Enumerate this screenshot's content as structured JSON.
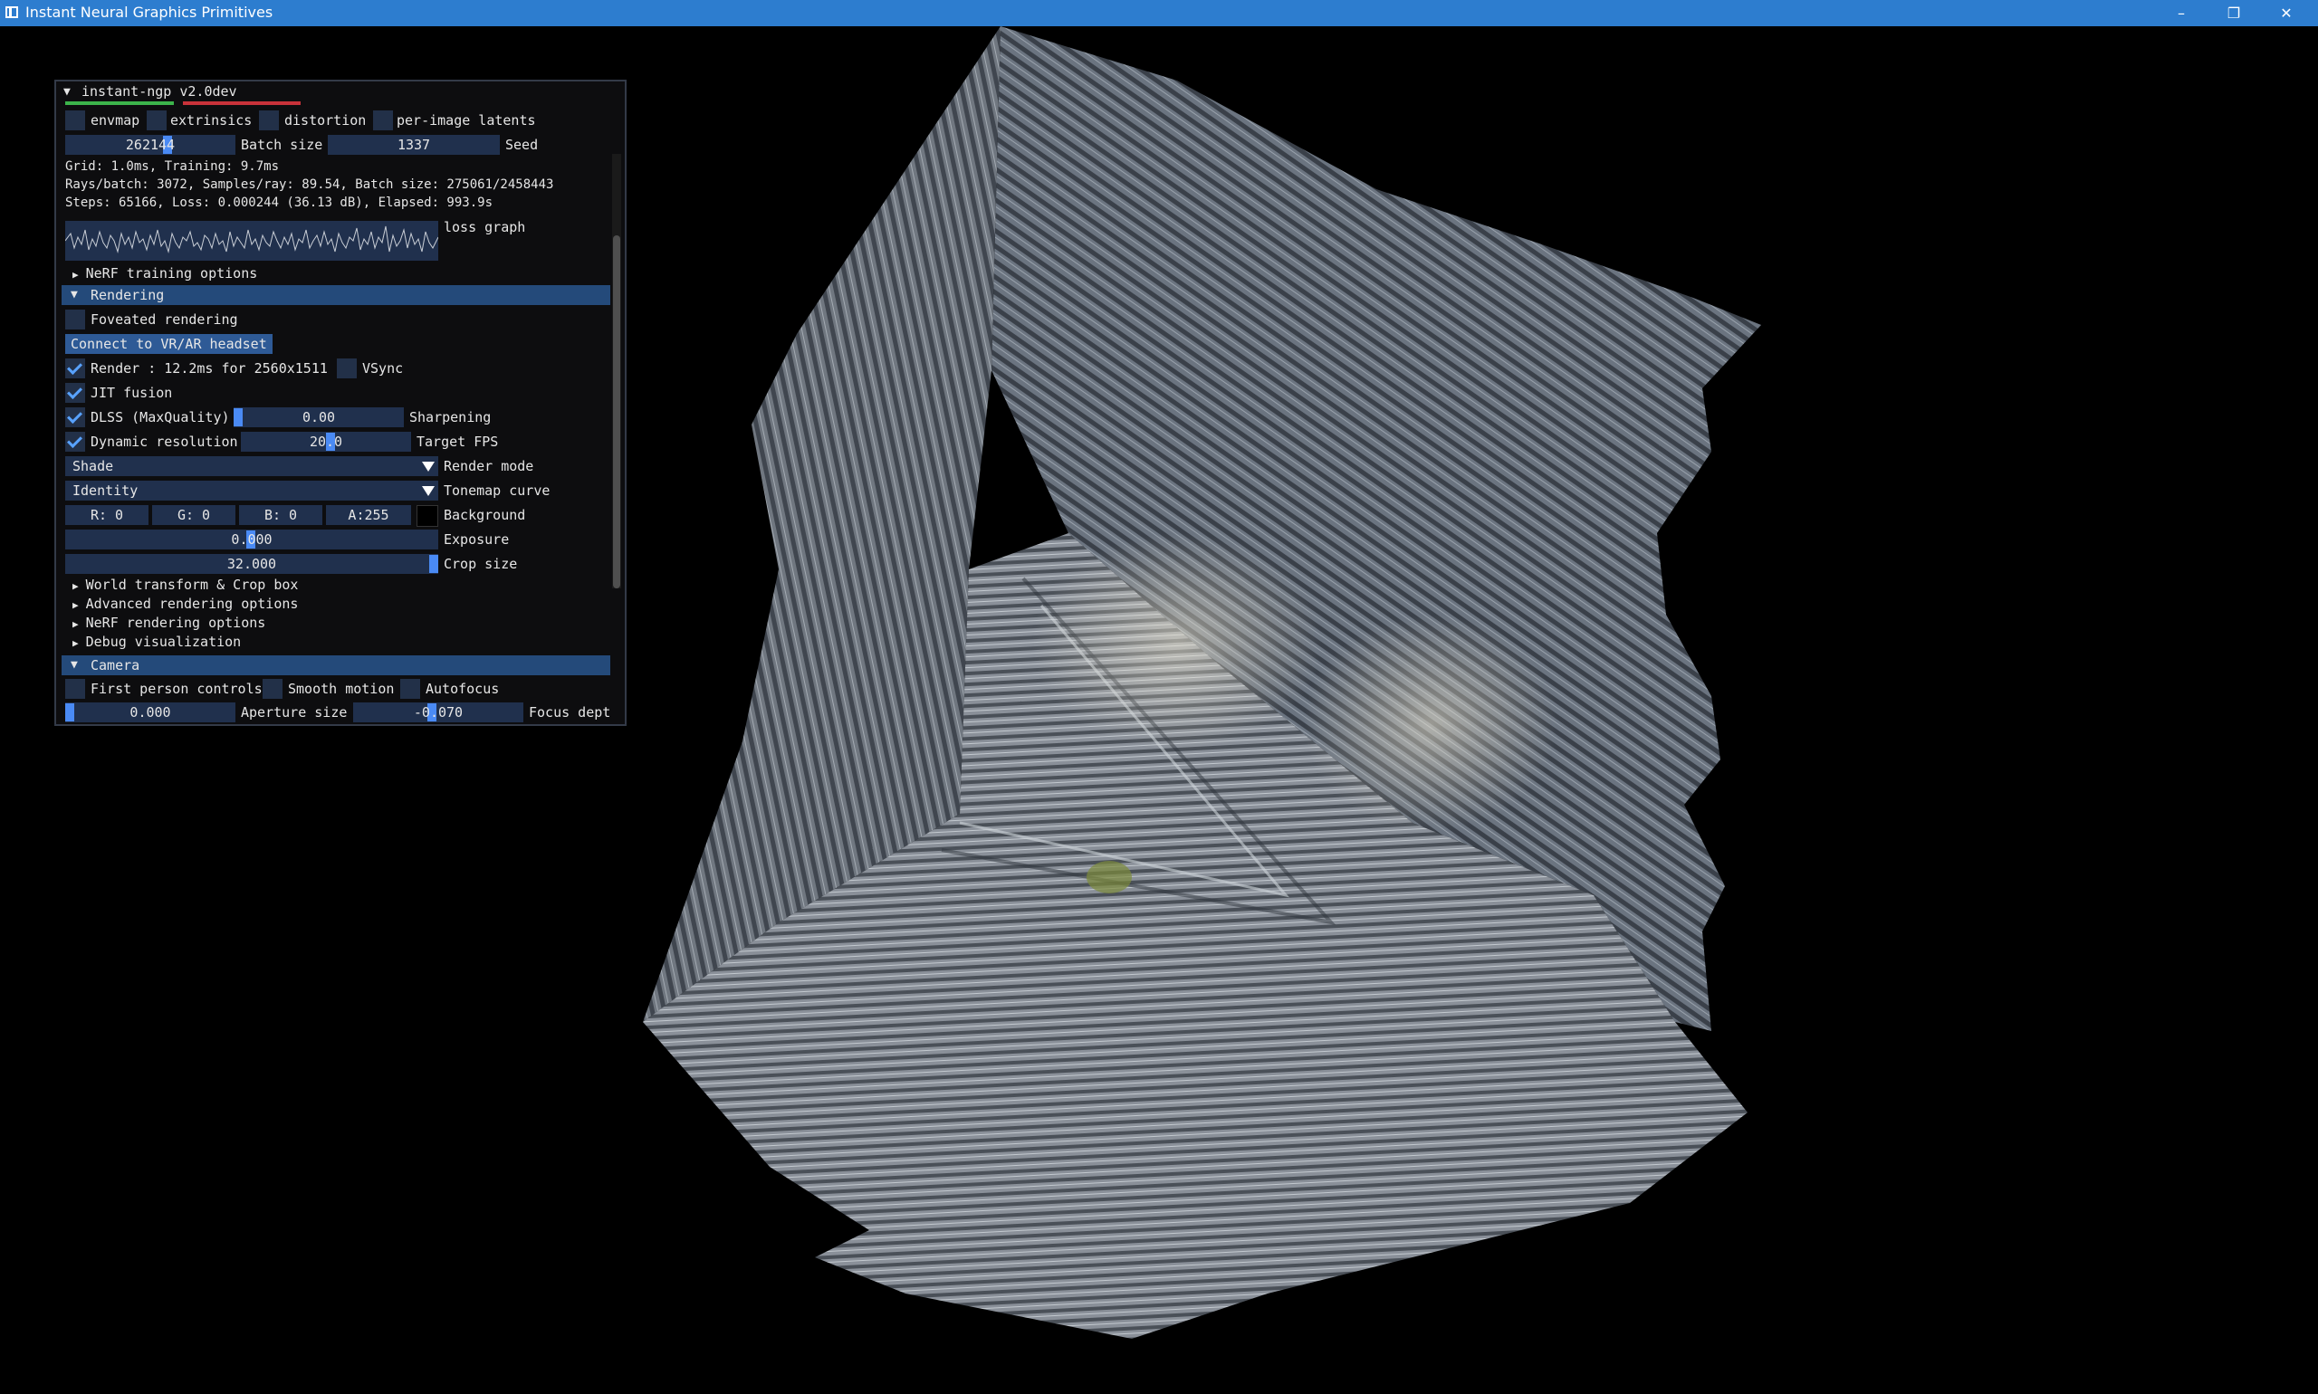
{
  "window": {
    "title": "Instant Neural Graphics Primitives",
    "minimize": "–",
    "maximize": "❐",
    "close": "✕"
  },
  "panel": {
    "title": "instant-ngp v2.0dev",
    "checks_top": {
      "envmap": "envmap",
      "extrinsics": "extrinsics",
      "distortion": "distortion",
      "latents": "per-image latents"
    },
    "batch_value": "262144",
    "batch_label": "Batch size",
    "seed_value": "1337",
    "seed_label": "Seed",
    "info": {
      "line1": "Grid: 1.0ms, Training: 9.7ms",
      "line2": "Rays/batch: 3072, Samples/ray: 89.54, Batch size: 275061/2458443",
      "line3": "Steps: 65166, Loss: 0.000244 (36.13 dB), Elapsed: 993.9s"
    },
    "loss_graph_label": "loss graph",
    "nerf_training": "NeRF training options",
    "rendering": {
      "header": "Rendering",
      "foveated": "Foveated rendering",
      "vr_button": "Connect to VR/AR headset",
      "render_stat": "Render : 12.2ms for 2560x1511",
      "vsync": "VSync",
      "jit": "JIT fusion",
      "dlss": "DLSS (MaxQuality)",
      "sharpening_value": "0.00",
      "sharpening_label": "Sharpening",
      "dynres": "Dynamic resolution",
      "target_fps_value": "20.0",
      "target_fps_label": "Target FPS",
      "render_mode_value": "Shade",
      "render_mode_label": "Render mode",
      "tonemap_value": "Identity",
      "tonemap_label": "Tonemap curve",
      "bg_r": "R:  0",
      "bg_g": "G:  0",
      "bg_b": "B:  0",
      "bg_a": "A:255",
      "bg_label": "Background",
      "bg_color": "#000000",
      "exposure_value": "0.000",
      "exposure_label": "Exposure",
      "crop_value": "32.000",
      "crop_label": "Crop size",
      "world_transform": "World transform & Crop box",
      "advanced": "Advanced rendering options",
      "nerf_rendering": "NeRF rendering options",
      "debug": "Debug visualization"
    },
    "camera": {
      "header": "Camera",
      "first_person": "First person controls",
      "smooth": "Smooth motion",
      "autofocus": "Autofocus",
      "aperture_value": "0.000",
      "aperture_label": "Aperture size",
      "focus_value": "-0.070",
      "focus_label": "Focus dept"
    }
  },
  "colors": {
    "accent": "#4a8af4",
    "header_bg": "#244a7a",
    "field_bg": "#20304d",
    "titlebar": "#2d7dcf"
  }
}
